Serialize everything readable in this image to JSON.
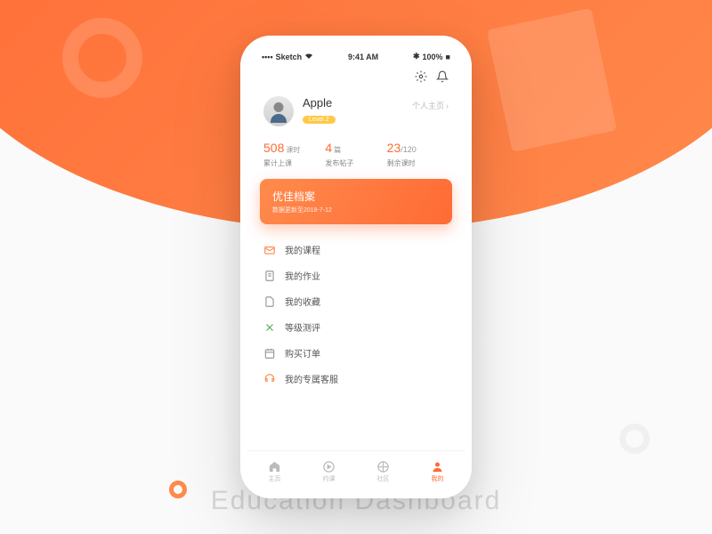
{
  "background": {
    "title": "Education                    Dashboard"
  },
  "status_bar": {
    "carrier": "Sketch",
    "time": "9:41 AM",
    "battery": "100%"
  },
  "profile": {
    "username": "Apple",
    "level_label": "Level 2",
    "homepage_label": "个人主页"
  },
  "stats": [
    {
      "value": "508",
      "unit": "课时",
      "label": "累计上课"
    },
    {
      "value": "4",
      "unit": "篇",
      "label": "发布帖子"
    },
    {
      "value": "23",
      "max": "/120",
      "label": "剩余课时"
    }
  ],
  "banner": {
    "title": "优佳档案",
    "subtitle": "数据更新至2018-7-12"
  },
  "menu": [
    {
      "icon": "mail",
      "label": "我的课程"
    },
    {
      "icon": "doc",
      "label": "我的作业"
    },
    {
      "icon": "file",
      "label": "我的收藏"
    },
    {
      "icon": "cross",
      "label": "等级测评"
    },
    {
      "icon": "calendar",
      "label": "购买订单"
    },
    {
      "icon": "headset",
      "label": "我的专属客服"
    }
  ],
  "tabs": [
    {
      "icon": "home",
      "label": "主页"
    },
    {
      "icon": "play",
      "label": "约课"
    },
    {
      "icon": "compass",
      "label": "社区"
    },
    {
      "icon": "user",
      "label": "我的"
    }
  ]
}
